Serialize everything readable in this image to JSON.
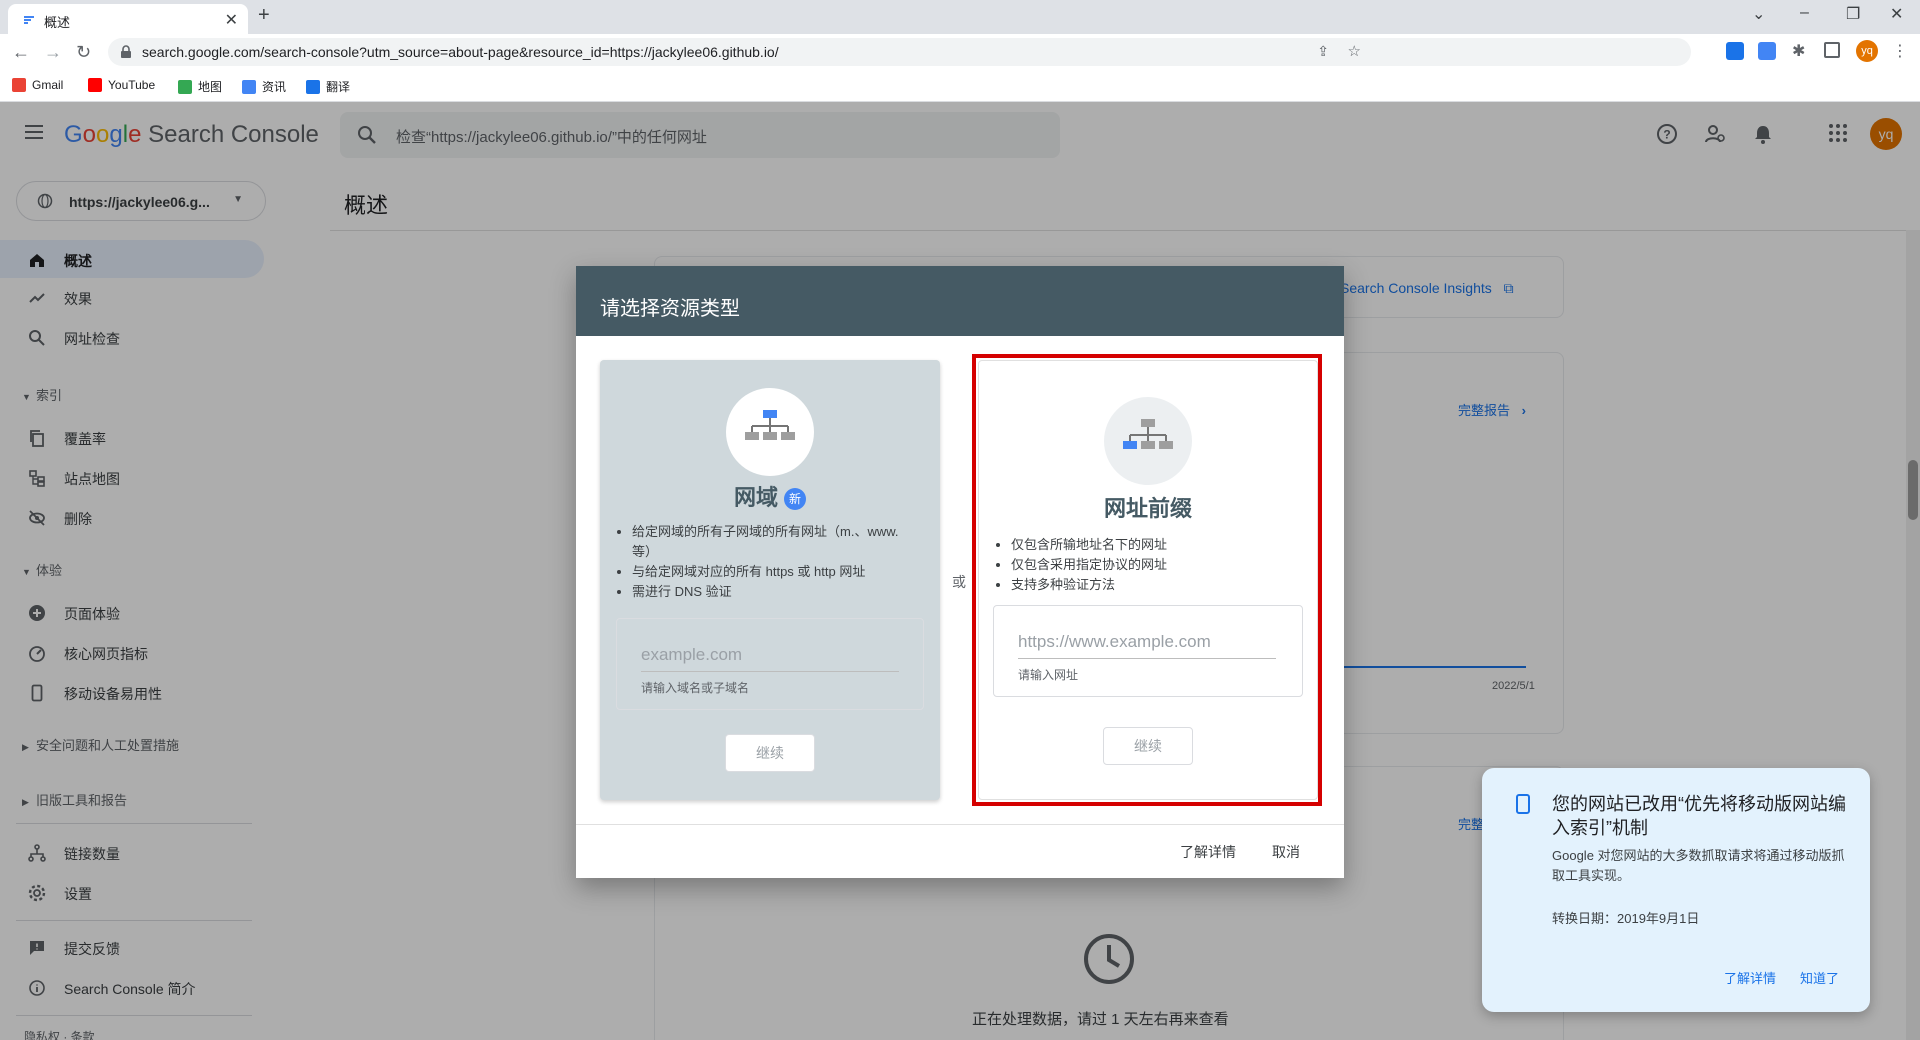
{
  "browser": {
    "tab_title": "概述",
    "url": "search.google.com/search-console?utm_source=about-page&resource_id=https://jackylee06.github.io/",
    "bookmarks": [
      "Gmail",
      "YouTube",
      "地图",
      "资讯",
      "翻译"
    ]
  },
  "header": {
    "logo_google": [
      "G",
      "o",
      "o",
      "g",
      "l",
      "e"
    ],
    "logo_product": "Search Console",
    "search_placeholder": "检查“https://jackylee06.github.io/”中的任何网址",
    "avatar": "yq"
  },
  "sidebar": {
    "property": "https://jackylee06.g...",
    "items": [
      {
        "label": "概述",
        "icon": "home-icon"
      },
      {
        "label": "效果",
        "icon": "trending-icon"
      },
      {
        "label": "网址检查",
        "icon": "search-icon"
      }
    ],
    "section_index": "索引",
    "index_items": [
      {
        "label": "覆盖率",
        "icon": "copy-icon"
      },
      {
        "label": "站点地图",
        "icon": "sitemap-icon"
      },
      {
        "label": "删除",
        "icon": "visibility-off-icon"
      }
    ],
    "section_experience": "体验",
    "experience_items": [
      {
        "label": "页面体验",
        "icon": "plus-circle-icon"
      },
      {
        "label": "核心网页指标",
        "icon": "speed-icon"
      },
      {
        "label": "移动设备易用性",
        "icon": "phone-icon"
      }
    ],
    "section_security": "安全问题和人工处置措施",
    "section_legacy": "旧版工具和报告",
    "links": [
      {
        "label": "链接数量",
        "icon": "link-tree-icon"
      },
      {
        "label": "设置",
        "icon": "gear-icon"
      }
    ],
    "footer": [
      {
        "label": "提交反馈",
        "icon": "feedback-icon"
      },
      {
        "label": "Search Console 简介",
        "icon": "info-icon"
      }
    ],
    "bottom_cutoff": "隐私权 · 条款"
  },
  "main": {
    "title": "概述",
    "insights_link": "Search Console Insights",
    "full_report": "完整报告",
    "full_report_2": "完整",
    "chart_date": "2022/5/1",
    "processing": "正在处理数据，请过 1 天左右再来查看"
  },
  "dialog": {
    "title": "请选择资源类型",
    "or": "或",
    "domain": {
      "title": "网域",
      "badge": "新",
      "bullets": [
        "给定网域的所有子网域的所有网址（m.、www. 等）",
        "与给定网域对应的所有 https 或 http 网址",
        "需进行 DNS 验证"
      ],
      "placeholder": "example.com",
      "help": "请输入域名或子域名",
      "button": "继续"
    },
    "prefix": {
      "title": "网址前缀",
      "bullets": [
        "仅包含所输地址名下的网址",
        "仅包含采用指定协议的网址",
        "支持多种验证方法"
      ],
      "placeholder": "https://www.example.com",
      "help": "请输入网址",
      "button": "继续"
    },
    "learn_more": "了解详情",
    "cancel": "取消"
  },
  "notification": {
    "title": "您的网站已改用“优先将移动版网站编入索引”机制",
    "body": "Google 对您网站的大多数抓取请求将通过移动版抓取工具实现。",
    "date": "转换日期：2019年9月1日",
    "learn_more": "了解详情",
    "got_it": "知道了"
  }
}
